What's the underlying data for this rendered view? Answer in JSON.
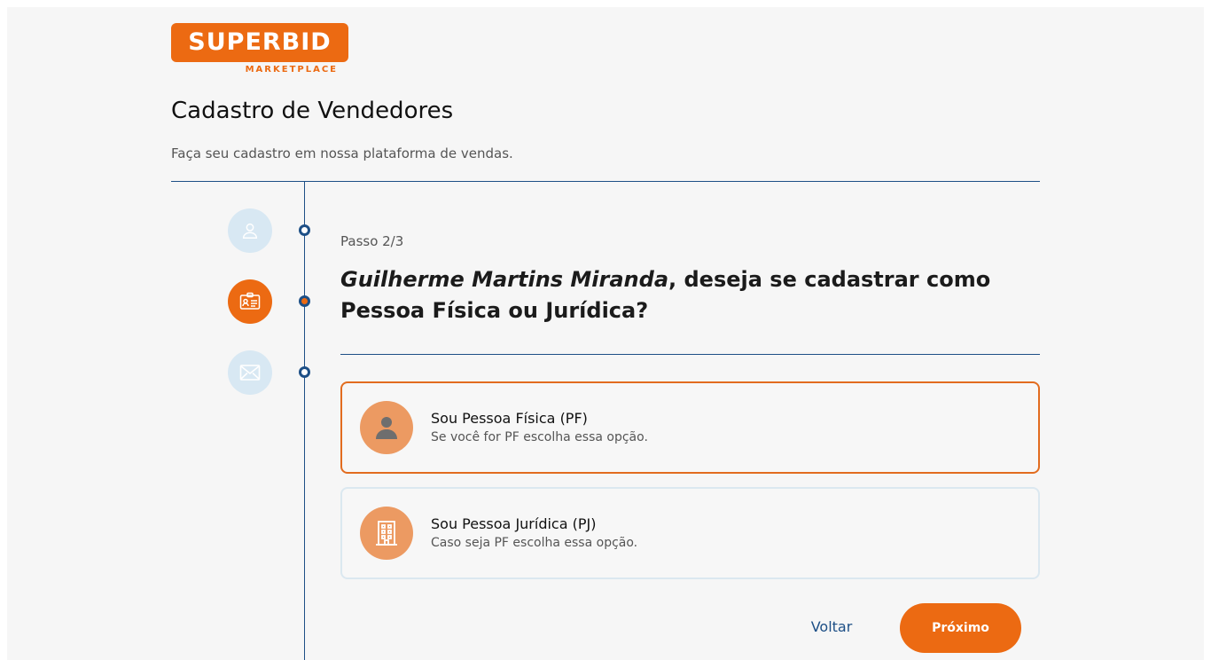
{
  "brand": {
    "name": "SUPERBID",
    "tagline": "MARKETPLACE",
    "color": "#ec6a12"
  },
  "header": {
    "title": "Cadastro de Vendedores",
    "subtitle": "Faça seu cadastro em nossa plataforma de vendas."
  },
  "steps": [
    {
      "icon": "user-icon",
      "status": "done"
    },
    {
      "icon": "id-card-icon",
      "status": "active"
    },
    {
      "icon": "mail-icon",
      "status": "pending"
    }
  ],
  "step_label": "Passo 2/3",
  "question": {
    "user_name": "Guilherme Martins Miranda",
    "text": ", deseja se cadastrar como Pessoa Física ou Jurídica?"
  },
  "options": [
    {
      "icon": "person-icon",
      "title": "Sou Pessoa Física (PF)",
      "description": "Se você for PF escolha essa opção.",
      "selected": true
    },
    {
      "icon": "building-icon",
      "title": "Sou Pessoa Jurídica (PJ)",
      "description": "Caso seja PF escolha essa opção.",
      "selected": false
    }
  ],
  "actions": {
    "back_label": "Voltar",
    "next_label": "Próximo"
  },
  "colors": {
    "accent": "#ec6a12",
    "primary": "#1d4f86",
    "light_blue": "#d8e8f3"
  }
}
